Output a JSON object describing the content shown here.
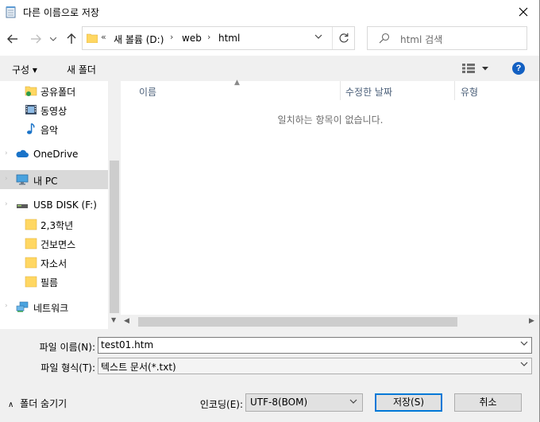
{
  "window": {
    "title": "다른 이름으로 저장"
  },
  "address": {
    "overflow": "«",
    "crumbs": [
      "새 볼륨 (D:)",
      "web",
      "html"
    ]
  },
  "search": {
    "placeholder": "html 검색"
  },
  "toolbar": {
    "organize": "구성 ▾",
    "new_folder": "새 폴더"
  },
  "nav": {
    "items": [
      {
        "label": "공유폴더",
        "icon": "share-folder-icon"
      },
      {
        "label": "동영상",
        "icon": "video-icon"
      },
      {
        "label": "음악",
        "icon": "music-icon"
      },
      {
        "label": "OneDrive",
        "icon": "cloud-icon"
      },
      {
        "label": "내 PC",
        "icon": "pc-icon"
      },
      {
        "label": "USB DISK (F:)",
        "icon": "usb-drive-icon"
      },
      {
        "label": "2,3학년",
        "icon": "folder-icon"
      },
      {
        "label": "건보면스",
        "icon": "folder-icon"
      },
      {
        "label": "자소서",
        "icon": "folder-icon"
      },
      {
        "label": "필름",
        "icon": "folder-icon"
      },
      {
        "label": "네트워크",
        "icon": "network-icon"
      }
    ]
  },
  "columns": {
    "name": "이름",
    "modified": "수정한 날짜",
    "type": "유형"
  },
  "empty_message": "일치하는 항목이 없습니다.",
  "form": {
    "filename_label": "파일 이름(N):",
    "filename_value": "test01.htm",
    "filetype_label": "파일 형식(T):",
    "filetype_value": "텍스트 문서(*.txt)",
    "encoding_label": "인코딩(E):",
    "encoding_value": "UTF-8(BOM)"
  },
  "buttons": {
    "hide_folders": "폴더 숨기기",
    "save": "저장(S)",
    "cancel": "취소"
  },
  "colors": {
    "selection": "#cce8ff",
    "accent": "#0078d7",
    "help": "#1360c2",
    "folder": "#ffd762"
  }
}
